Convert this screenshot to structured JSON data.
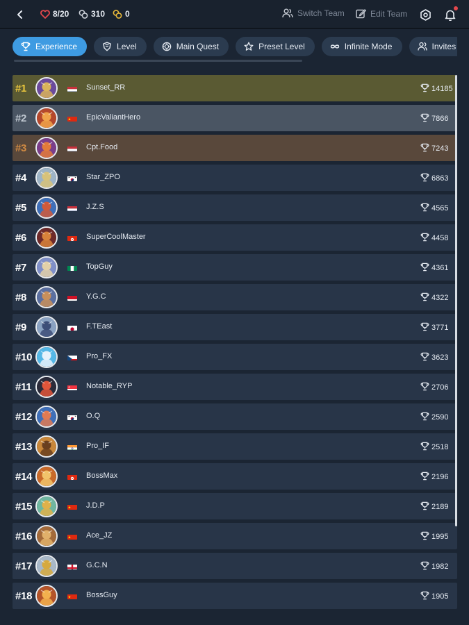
{
  "header": {
    "hearts": "8/20",
    "coins": "310",
    "keys": "0",
    "switch_team": "Switch Team",
    "edit_team": "Edit Team"
  },
  "tabs": [
    {
      "label": "Experience",
      "icon": "trophy-icon",
      "active": true
    },
    {
      "label": "Level",
      "icon": "shield-icon",
      "active": false
    },
    {
      "label": "Main Quest",
      "icon": "compass-icon",
      "active": false
    },
    {
      "label": "Preset Level",
      "icon": "star-icon",
      "active": false
    },
    {
      "label": "Infinite Mode",
      "icon": "infinity-icon",
      "active": false
    },
    {
      "label": "Invites",
      "icon": "users-icon",
      "active": false
    }
  ],
  "leaderboard": [
    {
      "rank": "#1",
      "name": "Sunset_RR",
      "score": "14185",
      "flag": "nl"
    },
    {
      "rank": "#2",
      "name": "EpicValiantHero",
      "score": "7866",
      "flag": "cn"
    },
    {
      "rank": "#3",
      "name": "Cpt.Food",
      "score": "7243",
      "flag": "nl"
    },
    {
      "rank": "#4",
      "name": "Star_ZPO",
      "score": "6863",
      "flag": "kr"
    },
    {
      "rank": "#5",
      "name": "J.Z.S",
      "score": "4565",
      "flag": "nl"
    },
    {
      "rank": "#6",
      "name": "SuperCoolMaster",
      "score": "4458",
      "flag": "hk"
    },
    {
      "rank": "#7",
      "name": "TopGuy",
      "score": "4361",
      "flag": "ng"
    },
    {
      "rank": "#8",
      "name": "Y.G.C",
      "score": "4322",
      "flag": "id"
    },
    {
      "rank": "#9",
      "name": "F.TEast",
      "score": "3771",
      "flag": "jp"
    },
    {
      "rank": "#10",
      "name": "Pro_FX",
      "score": "3623",
      "flag": "cz"
    },
    {
      "rank": "#11",
      "name": "Notable_RYP",
      "score": "2706",
      "flag": "sg"
    },
    {
      "rank": "#12",
      "name": "O.Q",
      "score": "2590",
      "flag": "kr"
    },
    {
      "rank": "#13",
      "name": "Pro_IF",
      "score": "2518",
      "flag": "in"
    },
    {
      "rank": "#14",
      "name": "BossMax",
      "score": "2196",
      "flag": "hk"
    },
    {
      "rank": "#15",
      "name": "J.D.P",
      "score": "2189",
      "flag": "cn"
    },
    {
      "rank": "#16",
      "name": "Ace_JZ",
      "score": "1995",
      "flag": "cn"
    },
    {
      "rank": "#17",
      "name": "G.C.N",
      "score": "1982",
      "flag": "gb"
    },
    {
      "rank": "#18",
      "name": "BossGuy",
      "score": "1905",
      "flag": "cn"
    }
  ],
  "colors": {
    "background": "#1b2533",
    "row": "#283548",
    "accent": "#3e9be2",
    "gold": "#e9c53c",
    "silver": "#bfc7d0",
    "bronze": "#d08a42",
    "heart": "#e5484d",
    "key": "#e9b93a"
  }
}
